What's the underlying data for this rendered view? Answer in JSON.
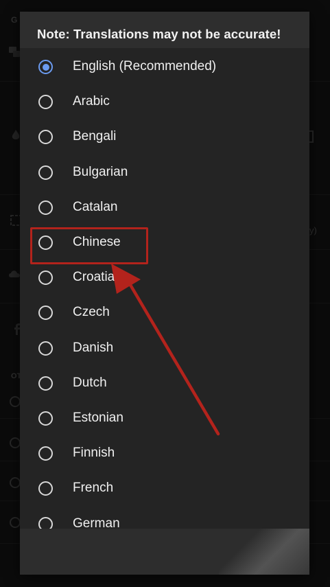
{
  "background": {
    "section_letters": [
      "G",
      "OT"
    ],
    "partial_text": [
      "y)"
    ]
  },
  "dialog": {
    "title": "Note: Translations may not be accurate!",
    "options": [
      {
        "label": "English (Recommended)",
        "selected": true
      },
      {
        "label": "Arabic",
        "selected": false
      },
      {
        "label": "Bengali",
        "selected": false
      },
      {
        "label": "Bulgarian",
        "selected": false
      },
      {
        "label": "Catalan",
        "selected": false
      },
      {
        "label": "Chinese",
        "selected": false
      },
      {
        "label": "Croatian",
        "selected": false
      },
      {
        "label": "Czech",
        "selected": false
      },
      {
        "label": "Danish",
        "selected": false
      },
      {
        "label": "Dutch",
        "selected": false
      },
      {
        "label": "Estonian",
        "selected": false
      },
      {
        "label": "Finnish",
        "selected": false
      },
      {
        "label": "French",
        "selected": false
      },
      {
        "label": "German",
        "selected": false
      }
    ]
  },
  "annotation": {
    "highlight_color": "#b3231c",
    "highlighted_option": "Chinese"
  },
  "colors": {
    "dialog_bg": "#242424",
    "header_bg": "#2e2e2e",
    "radio_selected": "#6b9bf0",
    "radio_unselected": "#d9d9d9"
  }
}
